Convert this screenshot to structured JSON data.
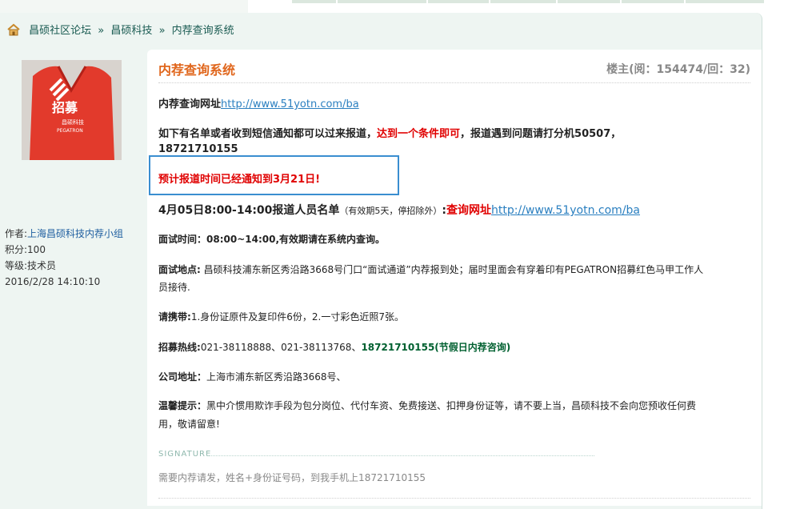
{
  "breadcrumb": {
    "home_icon": "home-icon",
    "items": [
      "昌硕社区论坛",
      "昌硕科技",
      "内荐查询系统"
    ],
    "separator": "»"
  },
  "author": {
    "label": "作者:",
    "name": "上海昌硕科技内荐小组",
    "points": "积分:100",
    "level": "等级:技术员",
    "date": "2016/2/28 14:10:10",
    "avatar_text": "招募",
    "avatar_subtext": "昌硕科技",
    "avatar_brand": "PEGATRON"
  },
  "post": {
    "title": "内荐查询系统",
    "stats": "楼主(阅：154474/回：32)",
    "query_label": "内荐查询网址",
    "query_url": "http://www.51yotn.com/ba",
    "notice_a": "如下有名单或者收到短信通知都可以过来报道，",
    "notice_b": "达到一个条件即可",
    "notice_c": "，报道遇到问题请打分机50507，",
    "notice_phone": "18721710155",
    "highlight": "预计报道时间已经通知到3月21日!",
    "list_label": "4月05日8:00-14:00报道人员名单",
    "list_note": "（有效期5天，停招除外）",
    "list_colon": ":",
    "list_link_label": "查询网址",
    "list_url": "http://www.51yotn.com/ba",
    "interview_time": "面试时间：08:00~14:00,有效期请在系统内查询。",
    "place_label": "面试地点:",
    "place_line1": " 昌硕科技浦东新区秀沿路3668号门口“面试通道”内荐报到处；届时里面会有穿着印有PEGATRON招募红色马甲工作人",
    "place_line2": "员接待.",
    "bring_label": "请携带:",
    "bring_text": "1.身份证原件及复印件6份，2.一寸彩色近照7张。",
    "hotline_label": "招募热线:",
    "hotline_numbers": "021-38118888、021-38113768、",
    "hotline_mobile": "18721710155(节假日内荐咨询)",
    "address_label": "公司地址：",
    "address_text": "上海市浦东新区秀沿路3668号、",
    "tip_label": "温馨提示：",
    "tip_line1": "黑中介惯用欺诈手段为包分岗位、代付车资、免费接送、扣押身份证等，请不要上当，昌硕科技不会向您预收任何费",
    "tip_line2": "用，敬请留意!"
  },
  "signature": {
    "label": "SIGNATURE",
    "text": "需要内荐请发，姓名+身份证号码，到我手机上18721710155"
  },
  "colors": {
    "title_orange": "#e0661c",
    "link_blue": "#2a7fc0",
    "alert_red": "#e00000",
    "hotline_green": "#006030",
    "frame_bg": "#eef5f2"
  }
}
